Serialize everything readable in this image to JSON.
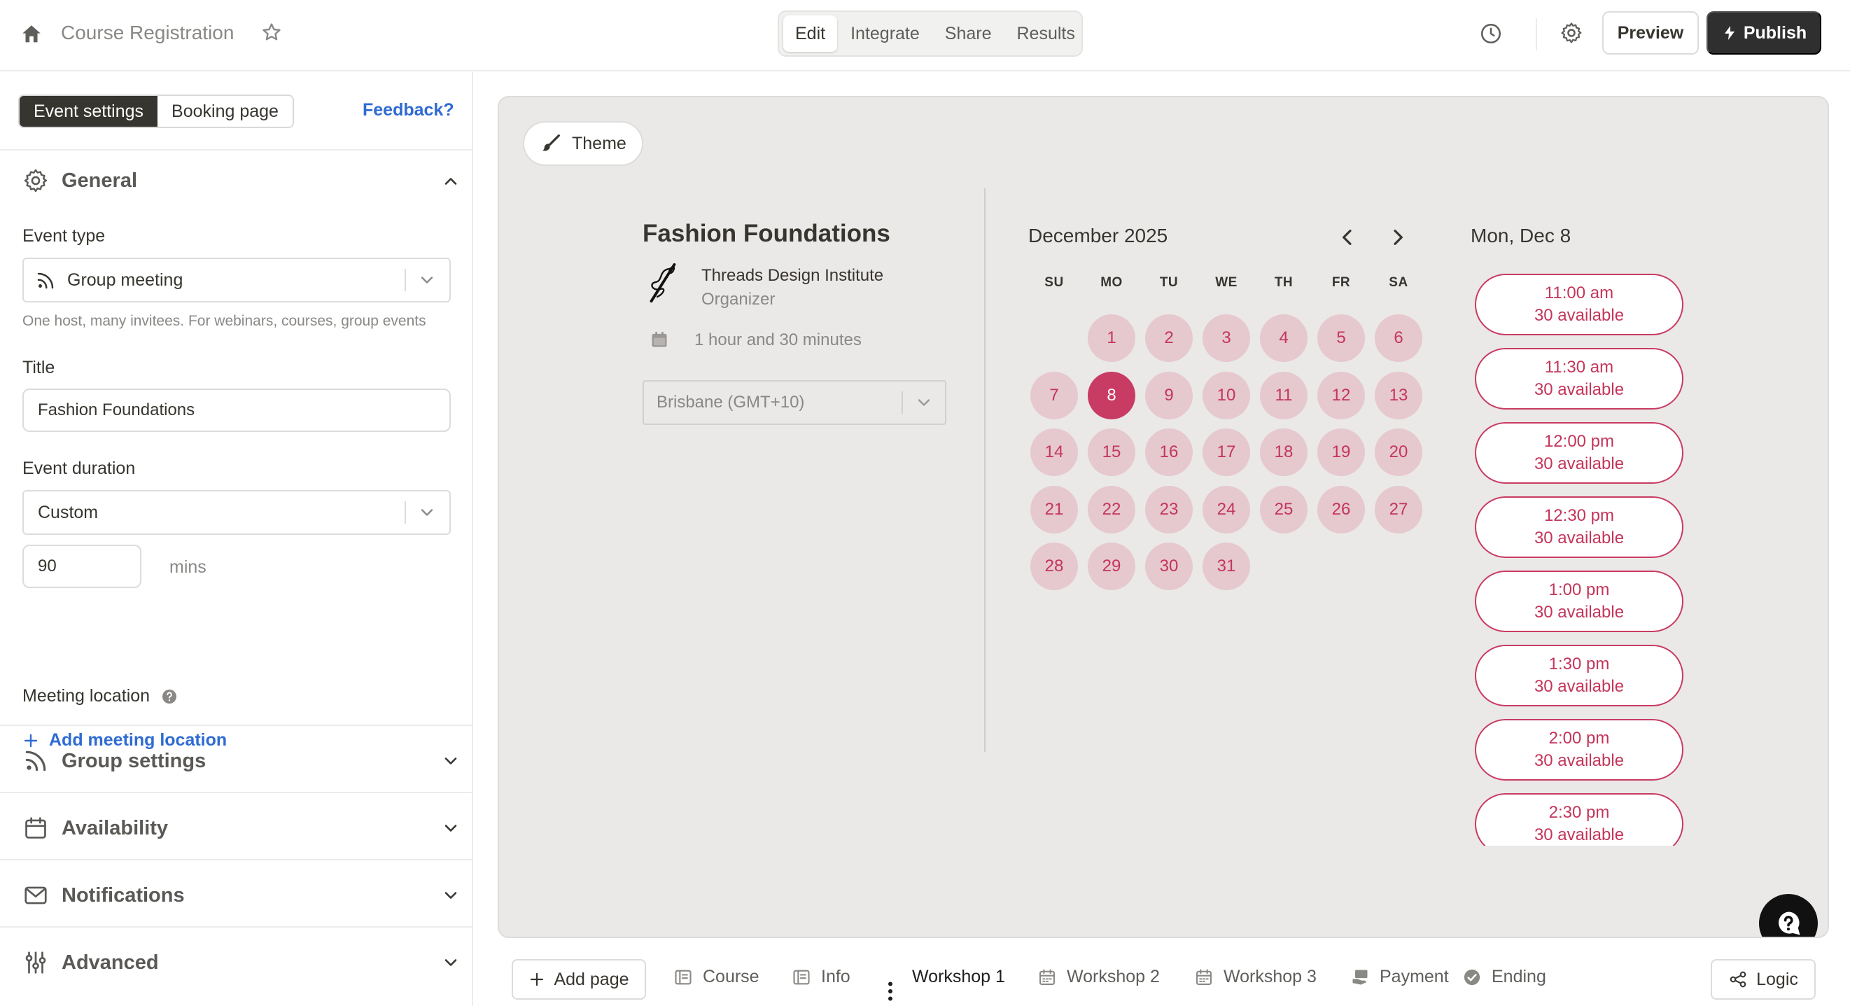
{
  "header": {
    "app_title": "Course Registration",
    "icons": {
      "home": "home-icon",
      "favorite": "star-icon",
      "history": "clock-icon",
      "settings": "gear-icon"
    },
    "mode_tabs": [
      {
        "label": "Edit",
        "active": true
      },
      {
        "label": "Integrate",
        "active": false
      },
      {
        "label": "Share",
        "active": false
      },
      {
        "label": "Results",
        "active": false
      }
    ],
    "preview_label": "Preview",
    "publish_label": "Publish"
  },
  "sidebar": {
    "segmented": [
      {
        "label": "Event settings",
        "active": true
      },
      {
        "label": "Booking page",
        "active": false
      }
    ],
    "feedback_label": "Feedback?",
    "general": {
      "title": "General",
      "expanded": true,
      "event_type_label": "Event type",
      "event_type_value": "Group meeting",
      "event_type_hint": "One host, many invitees. For webinars, courses, group events",
      "title_label": "Title",
      "title_value": "Fashion Foundations",
      "duration_label": "Event duration",
      "duration_value": "Custom",
      "duration_minutes": "90",
      "duration_unit": "mins",
      "location_label": "Meeting location",
      "add_location_label": "Add meeting location"
    },
    "sections": [
      {
        "title": "Group settings",
        "icon": "rss-icon"
      },
      {
        "title": "Availability",
        "icon": "calendar-icon"
      },
      {
        "title": "Notifications",
        "icon": "envelope-icon"
      },
      {
        "title": "Advanced",
        "icon": "sliders-icon"
      }
    ]
  },
  "canvas": {
    "background": "#ebe8e8",
    "accent": "#c83b62",
    "theme_label": "Theme",
    "event_title": "Fashion Foundations",
    "organizer_name": "Threads Design Institute",
    "organizer_role": "Organizer",
    "duration_text": "1 hour and 30 minutes",
    "timezone": "Brisbane (GMT+10)",
    "calendar": {
      "month": "December 2025",
      "weekdays": [
        "SU",
        "MO",
        "TU",
        "WE",
        "TH",
        "FR",
        "SA"
      ],
      "first_weekday_index": 1,
      "days_in_month": 31,
      "selected_day": 8
    },
    "selected_date_label": "Mon, Dec 8",
    "slots": [
      {
        "time": "11:00 am",
        "availability": "30 available"
      },
      {
        "time": "11:30 am",
        "availability": "30 available"
      },
      {
        "time": "12:00 pm",
        "availability": "30 available"
      },
      {
        "time": "12:30 pm",
        "availability": "30 available"
      },
      {
        "time": "1:00 pm",
        "availability": "30 available"
      },
      {
        "time": "1:30 pm",
        "availability": "30 available"
      },
      {
        "time": "2:00 pm",
        "availability": "30 available"
      },
      {
        "time": "2:30 pm",
        "availability": "30 available"
      }
    ]
  },
  "bottom_bar": {
    "add_page_label": "Add page",
    "pages": [
      {
        "label": "Course",
        "icon": "form-icon",
        "active": false
      },
      {
        "label": "Info",
        "icon": "form-icon",
        "active": false
      },
      {
        "label": "Workshop 1",
        "icon": "more-vertical-icon",
        "active": true
      },
      {
        "label": "Workshop 2",
        "icon": "calendar-icon",
        "active": false
      },
      {
        "label": "Workshop 3",
        "icon": "calendar-icon",
        "active": false
      },
      {
        "label": "Payment",
        "icon": "payment-icon",
        "active": false
      },
      {
        "label": "Ending",
        "icon": "check-circle-icon",
        "active": false
      }
    ],
    "logic_label": "Logic"
  }
}
